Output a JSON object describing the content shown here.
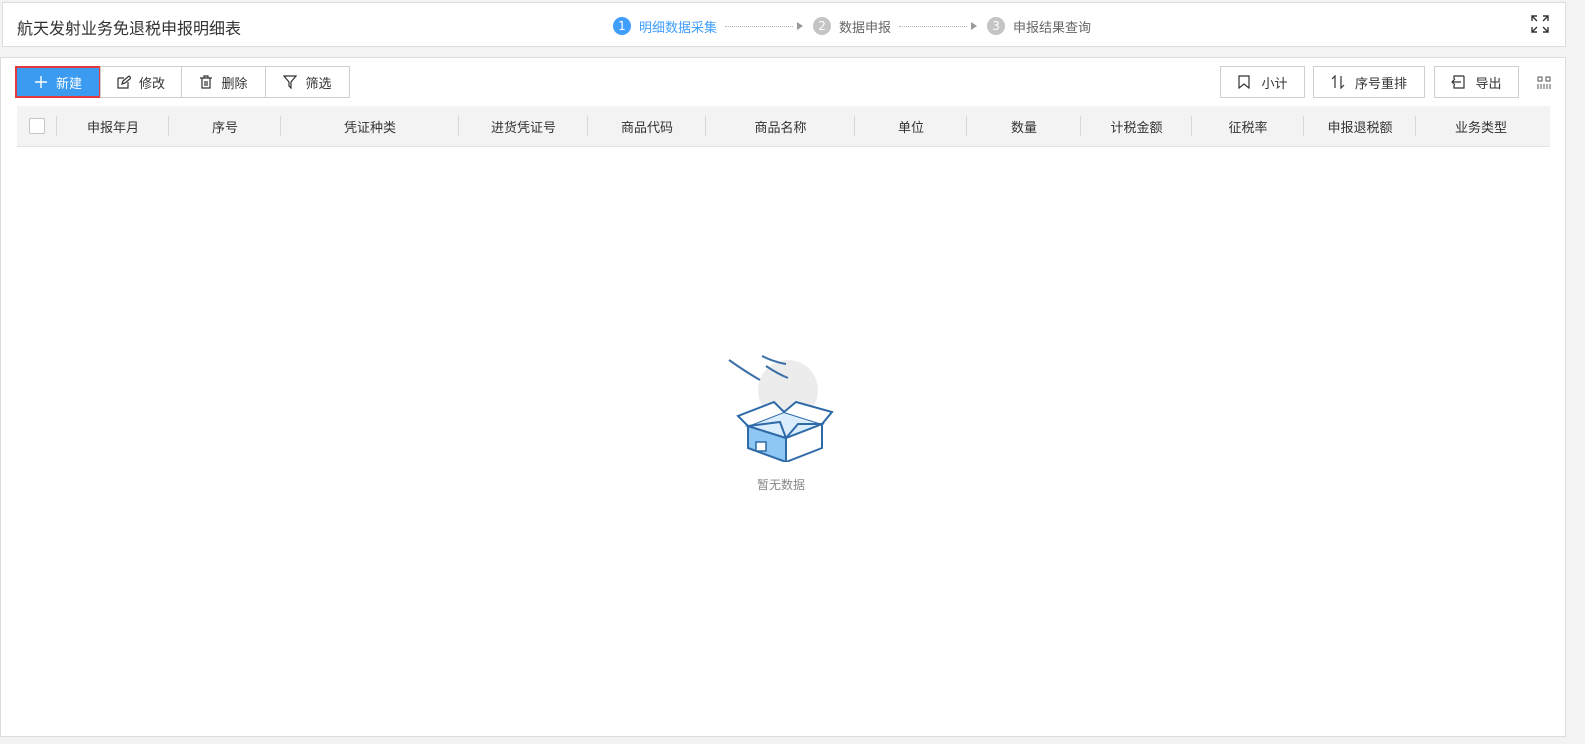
{
  "header": {
    "title": "航天发射业务免退税申报明细表",
    "steps": [
      {
        "num": "1",
        "label": "明细数据采集",
        "active": true
      },
      {
        "num": "2",
        "label": "数据申报",
        "active": false
      },
      {
        "num": "3",
        "label": "申报结果查询",
        "active": false
      }
    ]
  },
  "toolbar": {
    "new_label": "新建",
    "edit_label": "修改",
    "delete_label": "删除",
    "filter_label": "筛选",
    "subtotal_label": "小计",
    "reorder_label": "序号重排",
    "export_label": "导出"
  },
  "table": {
    "columns": [
      "申报年月",
      "序号",
      "凭证种类",
      "进货凭证号",
      "商品代码",
      "商品名称",
      "单位",
      "数量",
      "计税金额",
      "征税率",
      "申报退税额",
      "业务类型"
    ],
    "rows": []
  },
  "empty_text": "暂无数据",
  "colors": {
    "primary": "#409eff",
    "button_blue": "#3a9bf0",
    "highlight_red": "#e5383b"
  }
}
